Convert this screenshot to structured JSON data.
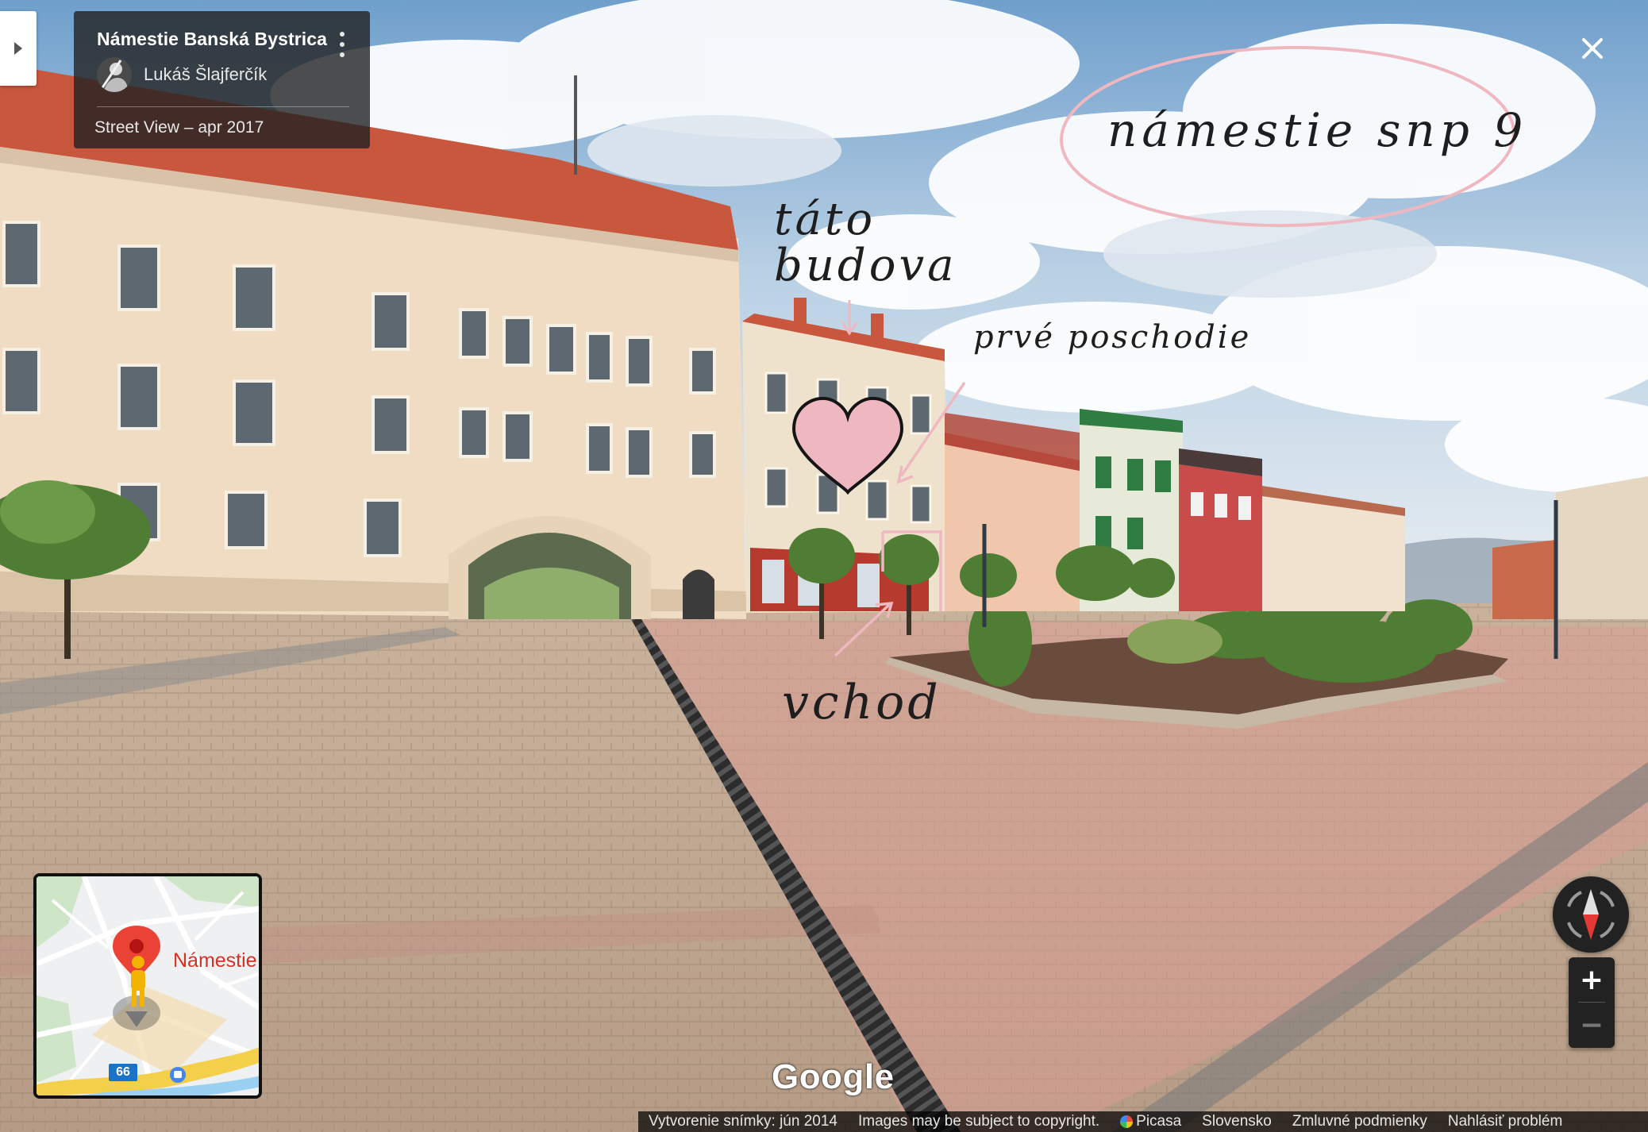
{
  "info_card": {
    "title": "Námestie Banská Bystrica",
    "author": "Lukáš Šlajferčík",
    "date": "Street View – apr 2017"
  },
  "annotations": {
    "address": "námestie snp 9",
    "building_line1": "táto",
    "building_line2": "budova",
    "floor": "prvé poschodie",
    "entrance": "vchod"
  },
  "minimap": {
    "place_label": "Námestie",
    "road_number": "66"
  },
  "zoom": {
    "in_label": "+",
    "out_label": "−"
  },
  "logo": "Google",
  "bottom_bar": {
    "capture_date": "Vytvorenie snímky: jún 2014",
    "copyright": "Images may be subject to copyright.",
    "picasa": "Picasa",
    "language": "Slovensko",
    "terms": "Zmluvné podmienky",
    "report": "Nahlásiť problém"
  },
  "colors": {
    "annotation_pink": "#efb8c0",
    "map_pin": "#ea4335",
    "pegman": "#f2b400",
    "compass_red": "#e53935"
  }
}
